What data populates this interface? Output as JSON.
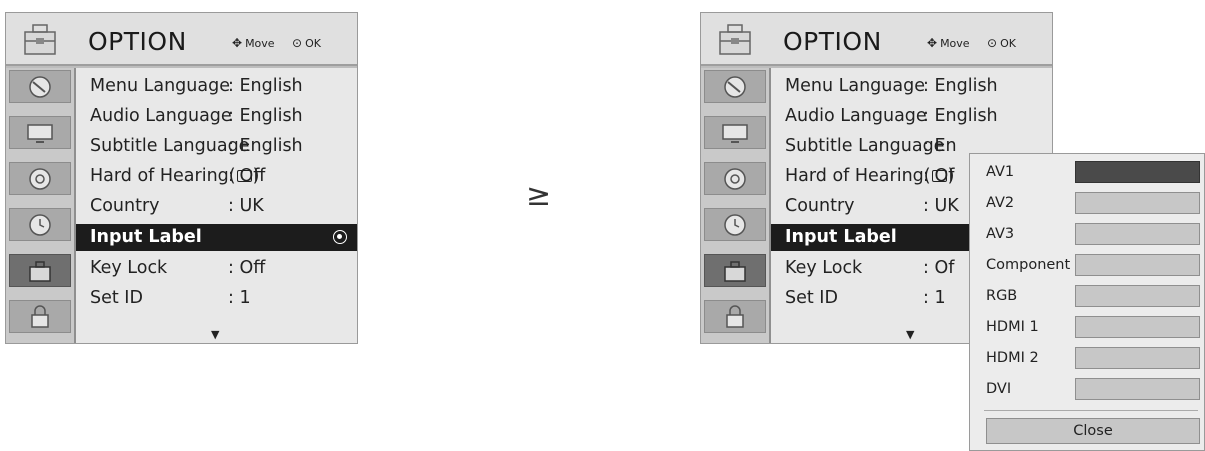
{
  "menu": {
    "title": "OPTION",
    "hint_move": "Move",
    "hint_ok": "OK",
    "items": [
      {
        "label": "Menu Language",
        "value": ": English"
      },
      {
        "label": "Audio Language",
        "value": ": English"
      },
      {
        "label": "Subtitle Language",
        "value": ": English"
      },
      {
        "label": "Hard of Hearing(",
        "label_suffix": ")",
        "value": ": Off"
      },
      {
        "label": "Country",
        "value": ": UK"
      },
      {
        "label": "Input Label",
        "value": ""
      },
      {
        "label": "Key Lock",
        "value": ": Off"
      },
      {
        "label": "Set ID",
        "value": ": 1"
      }
    ],
    "selected_index": 5,
    "sidebar_icons": [
      "satellite-dish-icon",
      "monitor-icon",
      "speaker-icon",
      "clock-icon",
      "toolbox-icon",
      "lock-icon"
    ],
    "active_tab": "toolbox-icon"
  },
  "right_menu_values": [
    ": English",
    ": English",
    ": En",
    ": Of",
    ": UK",
    "",
    ": Of",
    ": 1"
  ],
  "step_arrow": "≥",
  "popup": {
    "items": [
      "AV1",
      "AV2",
      "AV3",
      "Component",
      "RGB",
      "HDMI 1",
      "HDMI 2",
      "DVI"
    ],
    "selected_index": 0,
    "close_label": "Close"
  }
}
